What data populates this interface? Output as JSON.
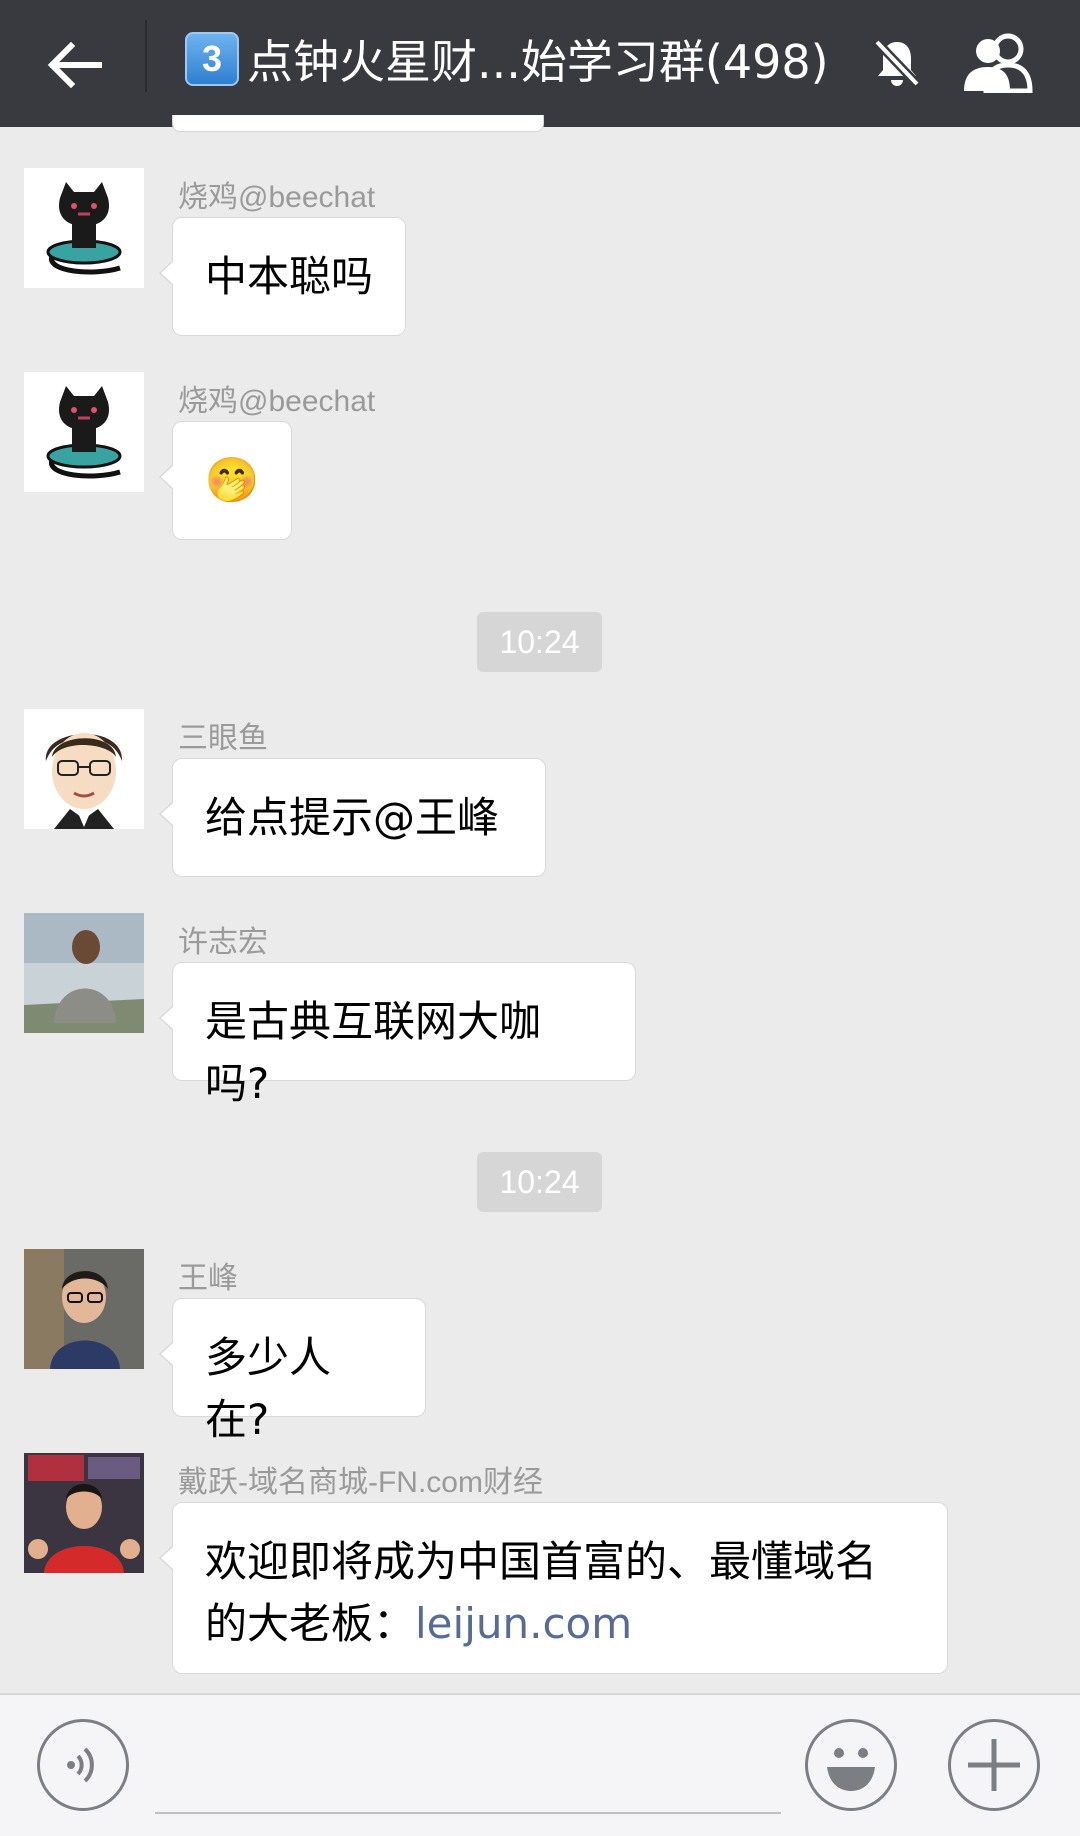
{
  "header": {
    "badge": "3",
    "title": "点钟火星财...始学习群(498)",
    "icons": {
      "back": "back-arrow-icon",
      "mute": "mute-bell-icon",
      "members": "group-members-icon"
    }
  },
  "messages": [
    {
      "sender": "烧鸡@beechat",
      "text": "中本聪吗",
      "avatar": "black-cat-avatar"
    },
    {
      "sender": "烧鸡@beechat",
      "emoji": "🤭",
      "avatar": "black-cat-avatar"
    },
    {
      "time": "10:24"
    },
    {
      "sender": "三眼鱼",
      "text": "给点提示@王峰",
      "avatar": "cartoon-man-avatar"
    },
    {
      "sender": "许志宏",
      "text": "是古典互联网大咖吗?",
      "avatar": "photo-avatar"
    },
    {
      "time": "10:24"
    },
    {
      "sender": "王峰",
      "text": "多少人在?",
      "avatar": "photo-avatar"
    },
    {
      "sender": "戴跃-域名商城-FN.com财经",
      "text": "欢迎即将成为中国首富的、最懂域名的大老板：",
      "link": "leijun.com",
      "avatar": "photo-avatar"
    }
  ],
  "input_bar": {
    "icons": {
      "voice": "voice-icon",
      "emoji": "emoji-icon",
      "plus": "plus-icon"
    }
  },
  "colors": {
    "header": "#393a3f",
    "background": "#ebebeb",
    "link": "#576b95",
    "time_pill": "#d6d6d6"
  }
}
